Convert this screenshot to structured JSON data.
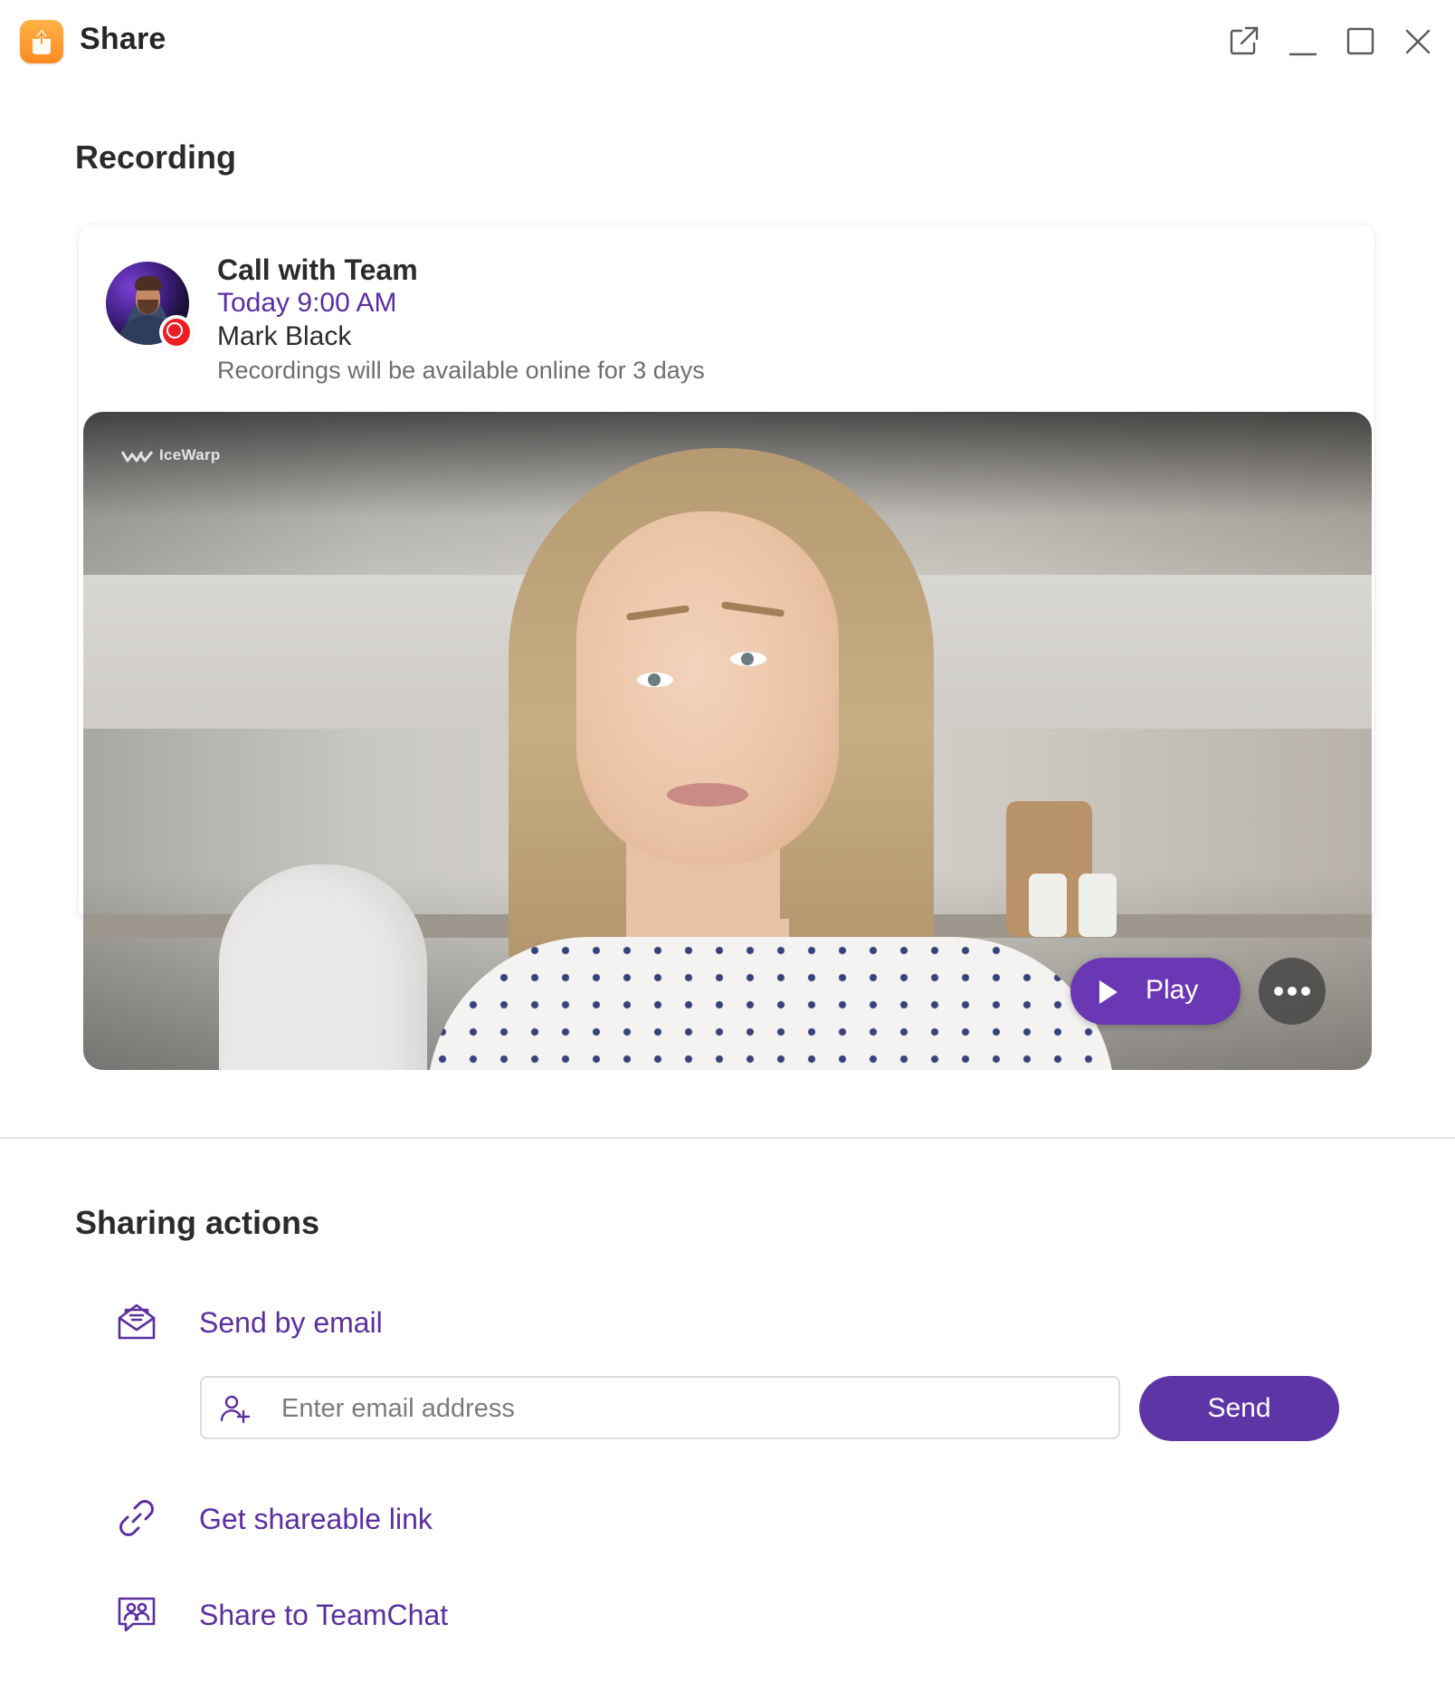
{
  "window": {
    "title": "Share",
    "icons": [
      "share-upload-icon",
      "pop-out-icon",
      "minimize-icon",
      "maximize-icon",
      "close-icon"
    ]
  },
  "recording": {
    "heading": "Recording",
    "title": "Call with Team",
    "time": "Today 9:00 AM",
    "owner": "Mark Black",
    "note": "Recordings will be available online for 3 days",
    "video": {
      "watermark": "IceWarp",
      "play_label": "Play"
    }
  },
  "sharing": {
    "heading": "Sharing actions",
    "email": {
      "label": "Send by email",
      "placeholder": "Enter email address",
      "value": "",
      "send_label": "Send"
    },
    "link_label": "Get shareable link",
    "teamchat_label": "Share to TeamChat"
  },
  "colors": {
    "accent": "#5d35a6",
    "accent_text": "#5b2fa0",
    "app_icon": "#ff9a2e",
    "recording_badge": "#ee1c25"
  }
}
